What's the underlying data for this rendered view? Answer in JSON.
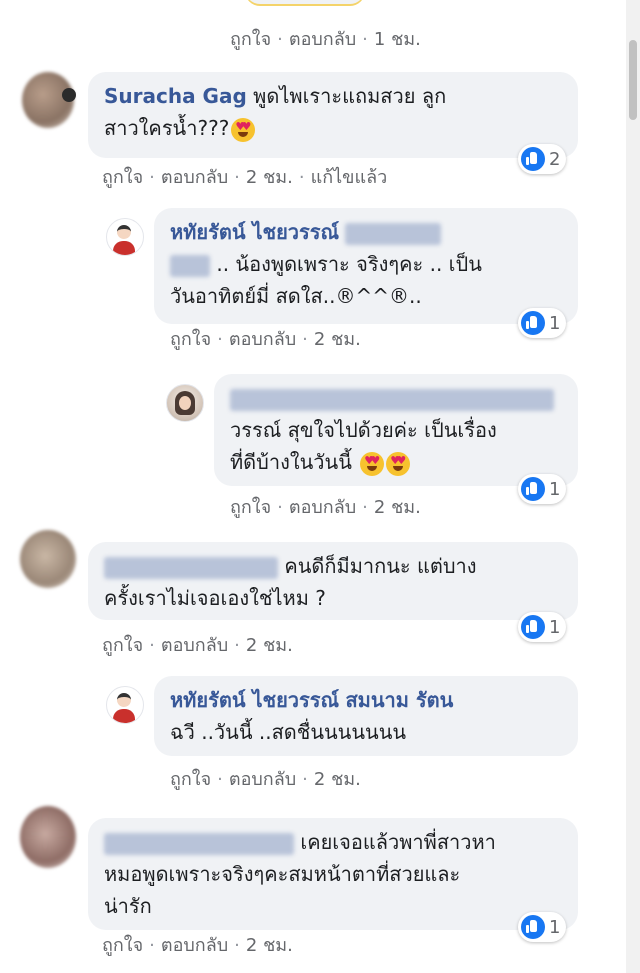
{
  "actions": {
    "like": "ถูกใจ",
    "reply": "ตอบกลับ",
    "edited": "แก้ไขแล้ว",
    "sep": "·"
  },
  "top_comment": {
    "time": "1 ชม."
  },
  "comments": [
    {
      "author": "Suracha Gag",
      "text": "พูดไพเราะแถมสวย ลูก",
      "text2": "สาวใครน้ำ???",
      "time": "2 ชม.",
      "likes": "2"
    },
    {
      "author": "หทัยรัตน์ ไชยวรรณ์",
      "text": "..  น้องพูดเพราะ จริงๆคะ .. เป็น",
      "text2": "วันอาทิตย์มี่ สดใส..®^^®..",
      "time": "2 ชม.",
      "likes": "1"
    },
    {
      "author": "",
      "text": "วรรณ์ สุขใจไปด้วยค่ะ เป็นเรื่อง",
      "text2": "ที่ดีบ้างในวันนี้",
      "time": "2 ชม.",
      "likes": "1"
    },
    {
      "author": "",
      "text": "คนดีก็มีมากนะ แต่บาง",
      "text2": "ครั้งเราไม่เจอเองใช่ไหม ?",
      "time": "2 ชม.",
      "likes": "1"
    },
    {
      "author": "หทัยรัตน์ ไชยวรรณ์",
      "text": "สมนาม รัตน",
      "text2": "ฉวี ..วันนี้ ..สดชื่นนนนนนน",
      "time": "2 ชม.",
      "likes": ""
    },
    {
      "author": "",
      "text": "เคยเจอแล้วพาพี่สาวหา",
      "text2": "หมอพูดเพราะจริงๆคะสมหน้าตาที่สวยและ",
      "text3": "น่ารัก",
      "time": "2 ชม.",
      "likes": "1"
    }
  ]
}
